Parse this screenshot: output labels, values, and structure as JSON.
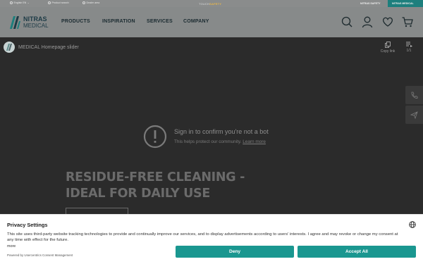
{
  "topbar": {
    "language": "English EN",
    "search": "Product search",
    "dealer": "Dealer area",
    "center_a": "TOUCH",
    "center_b": "SAFETY",
    "safety": "NITRAS SAFETY",
    "medical": "NITRAS MEDICAL"
  },
  "header": {
    "logo_line1": "NITRAS",
    "logo_line2": "MEDICAL",
    "nav": [
      "PRODUCTS",
      "INSPIRATION",
      "SERVICES",
      "COMPANY"
    ],
    "icons": [
      "search-icon",
      "user-icon",
      "heart-icon",
      "cart-icon"
    ]
  },
  "video": {
    "title": "MEDICAL Homepage slider",
    "copy_link": "Copy link",
    "pager": "1/1"
  },
  "bot_check": {
    "title": "Sign in to confirm you're not a bot",
    "subtitle": "This helps protect our community.",
    "learn_more": "Learn more"
  },
  "headline": {
    "line1": "RESIDUE-FREE CLEANING -",
    "line2": "IDEAL FOR DAILY USE"
  },
  "privacy": {
    "title": "Privacy Settings",
    "text": "This site uses third-party website tracking technologies to provide and continually improve our services, and to display advertisements according to users' interests. I agree and may revoke or change my consent at any time with effect for the future.",
    "more": "more",
    "powered": "Powered by Usercentrics Consent Management",
    "deny": "Deny",
    "accept": "Accept All"
  },
  "colors": {
    "accent": "#1a9790",
    "medical_tab": "#1d7f7d",
    "overlay": "#2b2b2b"
  }
}
